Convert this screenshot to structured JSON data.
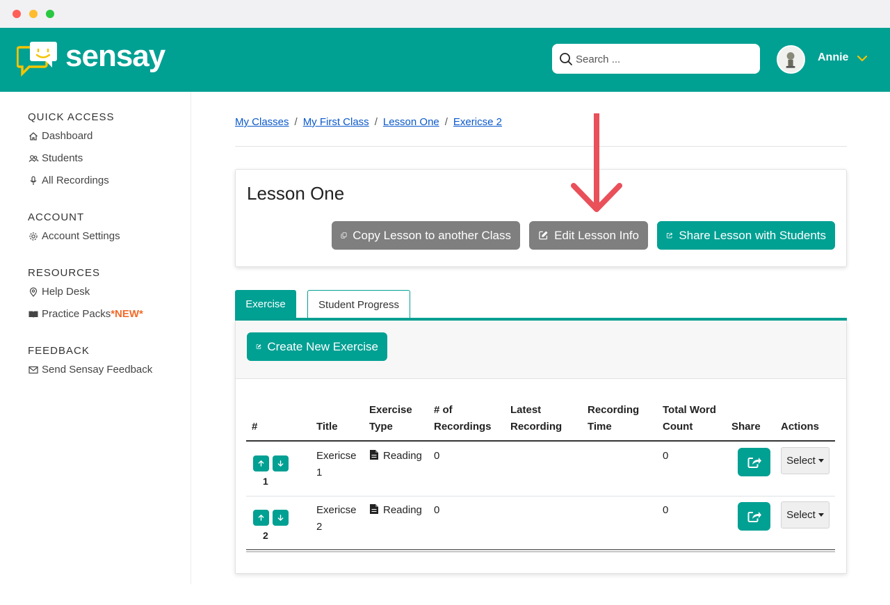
{
  "app": {
    "name": "sensay"
  },
  "search": {
    "placeholder": "Search ..."
  },
  "user": {
    "name": "Annie"
  },
  "sidebar": {
    "sections": [
      {
        "heading": "QUICK ACCESS",
        "items": [
          {
            "label": "Dashboard",
            "icon": "home-icon"
          },
          {
            "label": "Students",
            "icon": "users-icon"
          },
          {
            "label": "All Recordings",
            "icon": "microphone-icon"
          }
        ]
      },
      {
        "heading": "ACCOUNT",
        "items": [
          {
            "label": "Account Settings",
            "icon": "gear-icon"
          }
        ]
      },
      {
        "heading": "RESOURCES",
        "items": [
          {
            "label": "Help Desk",
            "icon": "location-pin-icon"
          },
          {
            "label": "Practice Packs",
            "badge": "*NEW*",
            "icon": "book-icon"
          }
        ]
      },
      {
        "heading": "FEEDBACK",
        "items": [
          {
            "label": "Send Sensay Feedback",
            "icon": "envelope-icon"
          }
        ]
      }
    ]
  },
  "breadcrumb": [
    "My Classes",
    "My First Class",
    "Lesson One",
    "Exericse 2"
  ],
  "breadcrumb_separator": "/",
  "lesson": {
    "title": "Lesson One",
    "copy_label": "Copy Lesson to another Class",
    "edit_label": "Edit Lesson Info",
    "share_label": "Share Lesson with Students"
  },
  "tabs": {
    "active": "Exercise",
    "inactive": "Student Progress"
  },
  "create_label": "Create New Exercise",
  "table": {
    "headers": {
      "num": "#",
      "title": "Title",
      "type_1": "Exercise",
      "type_2": "Type",
      "rec_1": "# of",
      "rec_2": "Recordings",
      "latest_1": "Latest",
      "latest_2": "Recording",
      "time_1": "Recording",
      "time_2": "Time",
      "words_1": "Total Word",
      "words_2": "Count",
      "share": "Share",
      "actions": "Actions"
    },
    "rows": [
      {
        "num": "1",
        "title_1": "Exericse",
        "title_2": "1",
        "type": "Reading",
        "recordings": "0",
        "latest": "",
        "time": "",
        "words": "0",
        "action": "Select"
      },
      {
        "num": "2",
        "title_1": "Exericse",
        "title_2": "2",
        "type": "Reading",
        "recordings": "0",
        "latest": "",
        "time": "",
        "words": "0",
        "action": "Select"
      }
    ]
  },
  "colors": {
    "brand": "#00a093",
    "annotation_arrow": "#e9505a",
    "new_badge": "#f26b2a",
    "gray_button": "#7f7f7f"
  }
}
